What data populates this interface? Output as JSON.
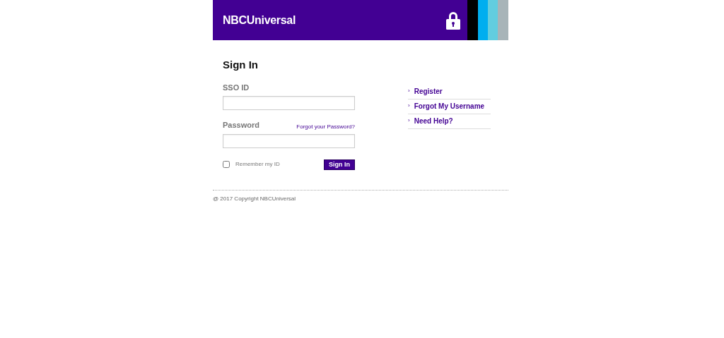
{
  "header": {
    "logo": "NBCUniversal"
  },
  "form": {
    "title": "Sign In",
    "username": {
      "label": "SSO ID"
    },
    "password": {
      "label": "Password",
      "link": "Forgot your Password?"
    },
    "remember": {
      "label": "Remember my ID",
      "checked": false
    },
    "submit": "Sign In"
  },
  "links": [
    {
      "marker": "›",
      "label": "Register"
    },
    {
      "marker": "›",
      "label": "Forgot My Username"
    },
    {
      "marker": "›",
      "label": "Need Help?"
    }
  ],
  "footer": "@ 2017 Copyright NBCUniversal"
}
